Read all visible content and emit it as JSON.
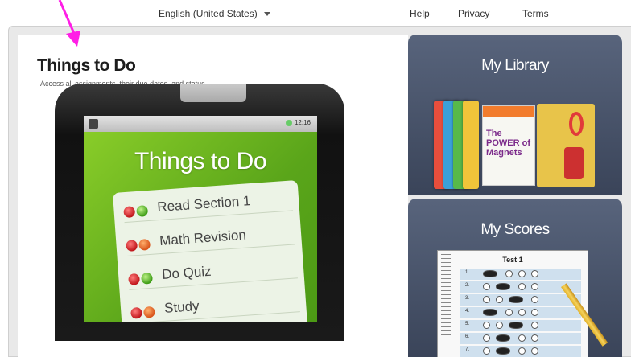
{
  "topbar": {
    "language": "English (United States)",
    "links": {
      "help": "Help",
      "privacy": "Privacy",
      "terms": "Terms"
    }
  },
  "annotation": {
    "color": "#ff1ee6",
    "icon": "arrow-icon"
  },
  "things_to_do": {
    "title": "Things to Do",
    "subtitle": "Access all assignments, their due dates, and status",
    "device": {
      "status_time": "12:16",
      "screen_title": "Things to Do",
      "tasks": [
        {
          "label": "Read Section 1",
          "status": [
            "red",
            "green"
          ]
        },
        {
          "label": "Math Revision",
          "status": [
            "red",
            "orange"
          ]
        },
        {
          "label": "Do Quiz",
          "status": [
            "red",
            "green"
          ]
        },
        {
          "label": "Study",
          "status": [
            "red",
            "orange"
          ]
        }
      ]
    }
  },
  "my_library": {
    "title": "My Library",
    "book_cover_text": "The POWER of Magnets"
  },
  "my_scores": {
    "title": "My Scores",
    "sheet_title": "Test 1",
    "rows": [
      "1.",
      "2.",
      "3.",
      "4.",
      "5.",
      "6.",
      "7."
    ]
  },
  "colors": {
    "screen_green": "#6fbf1f",
    "card_dark": "#4a546b"
  }
}
